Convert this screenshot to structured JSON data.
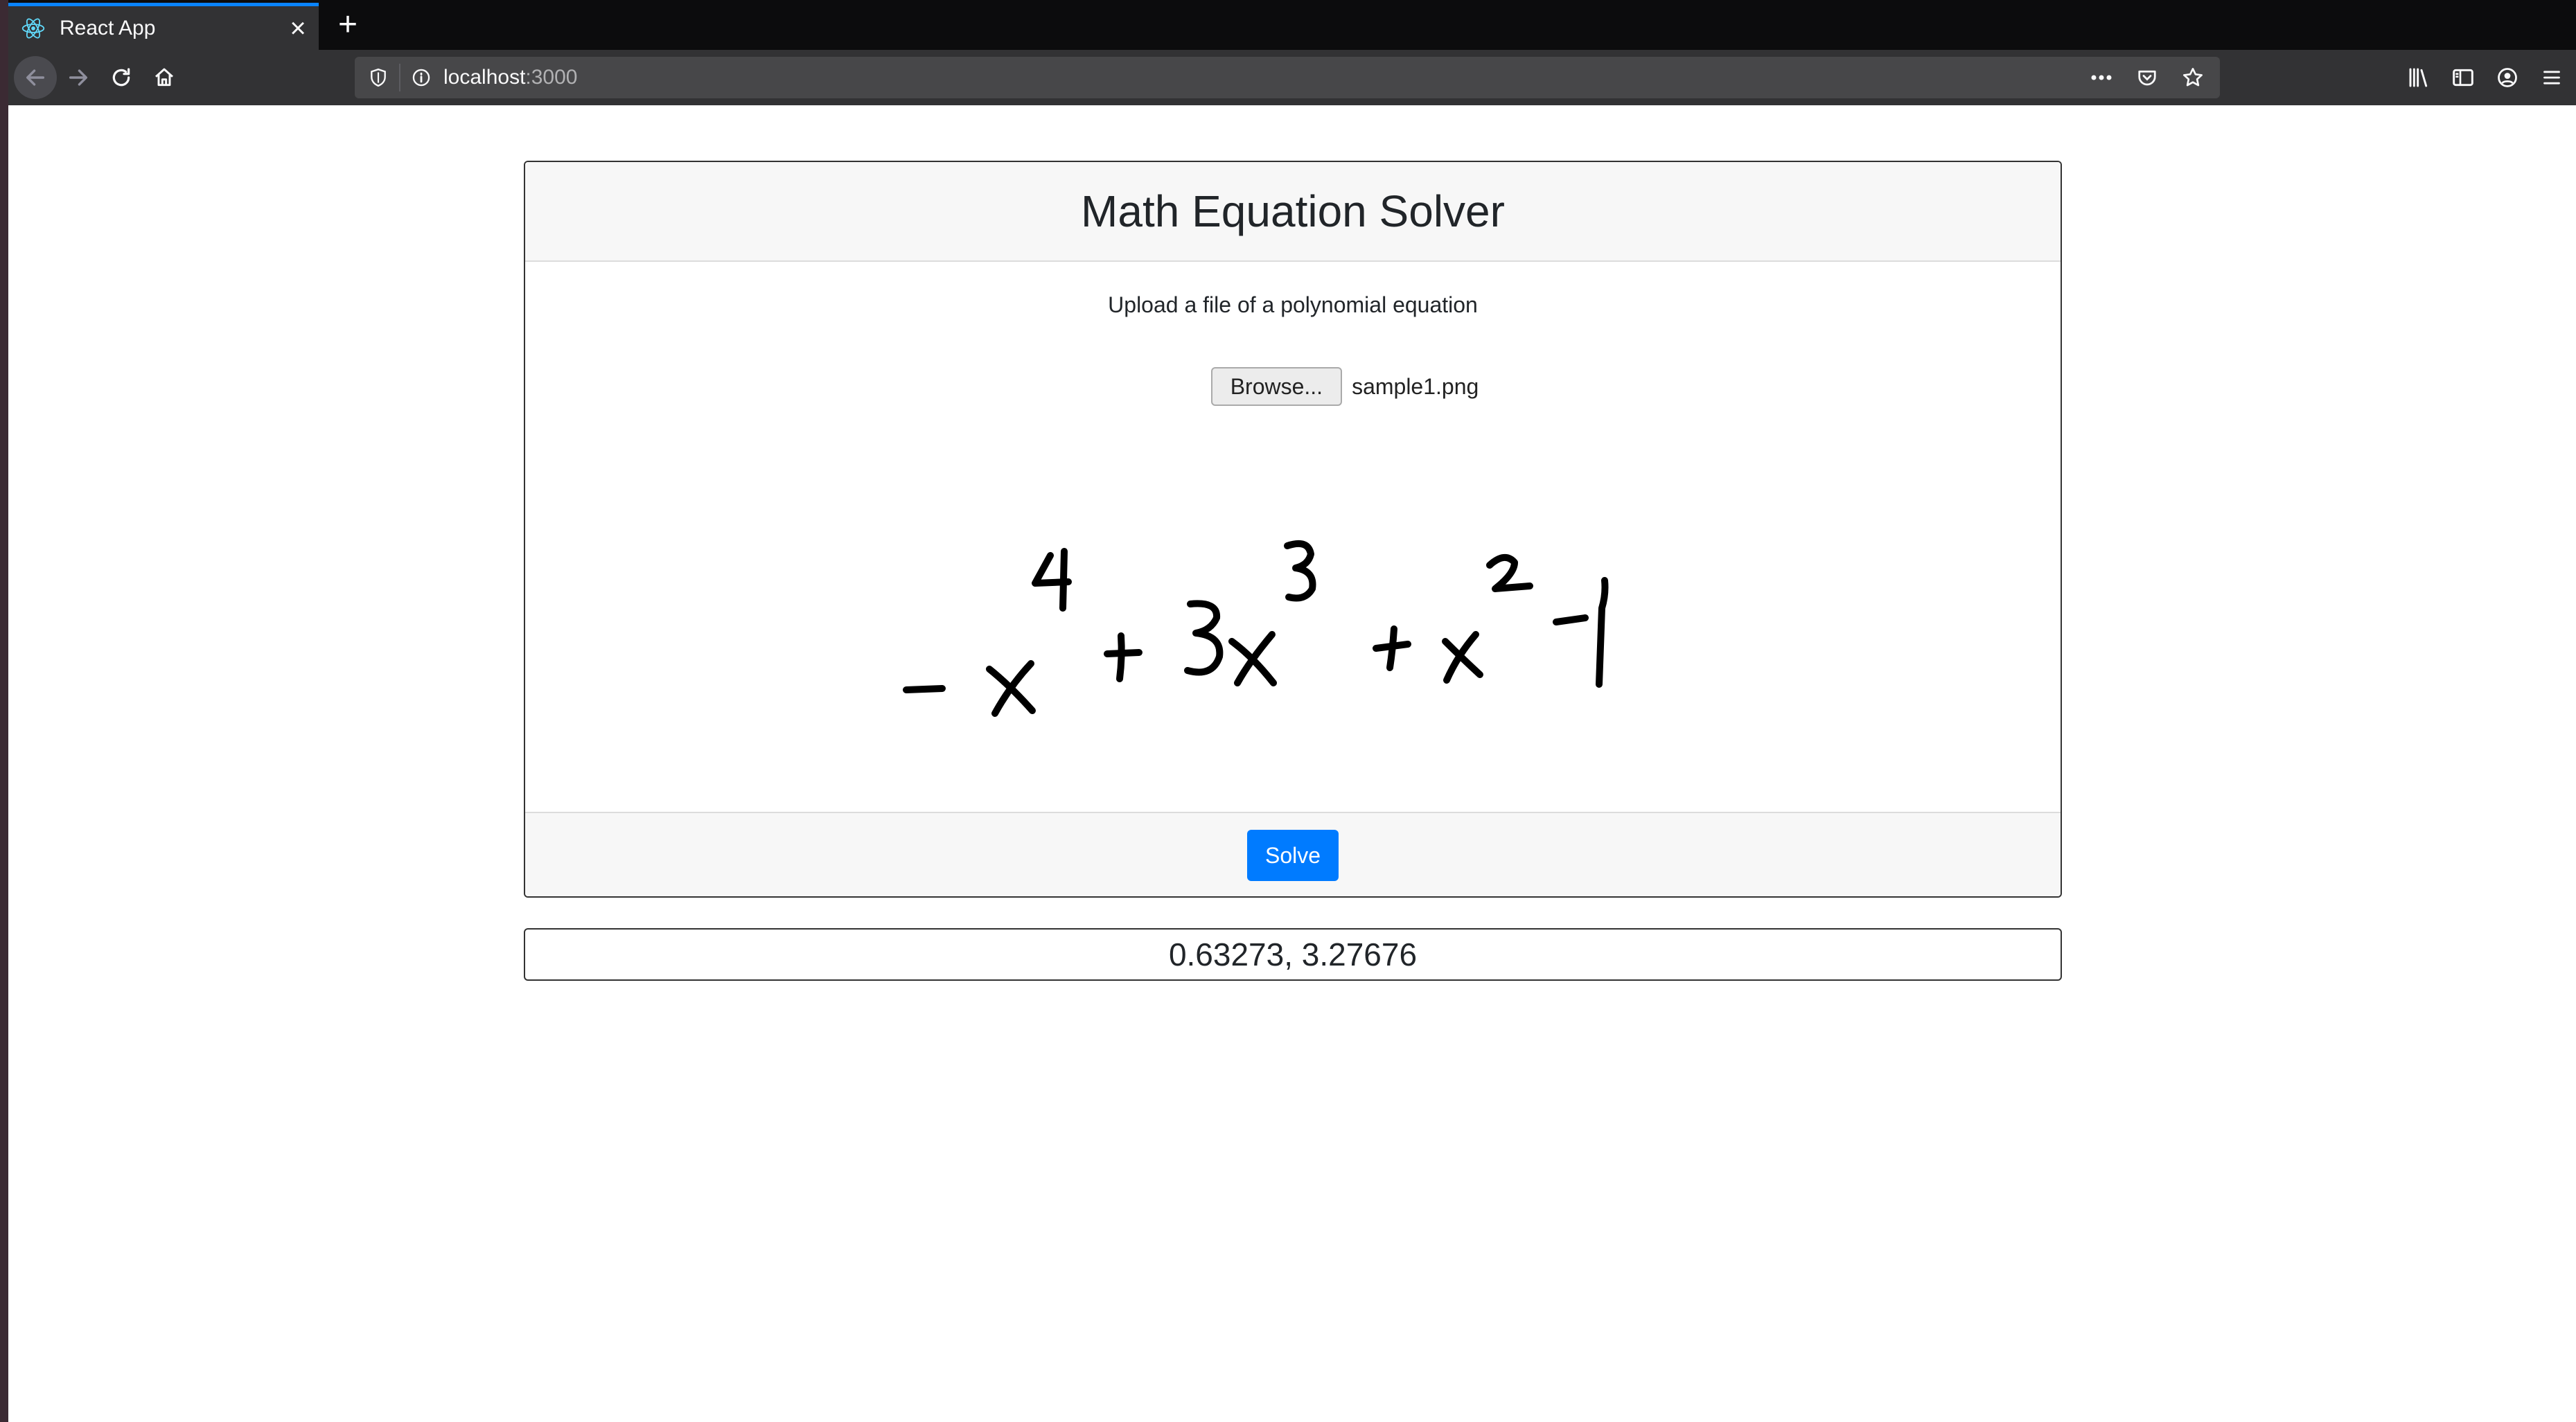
{
  "browser": {
    "tab_title": "React App",
    "url_host": "localhost",
    "url_port": ":3000"
  },
  "page": {
    "title": "Math Equation Solver",
    "instructions": "Upload a file of a polynomial equation",
    "browse_label": "Browse...",
    "file_name": "sample1.png",
    "solve_label": "Solve",
    "result": "0.63273, 3.27676"
  },
  "colors": {
    "accent": "#007bff",
    "tab_highlight": "#0a84ff"
  }
}
